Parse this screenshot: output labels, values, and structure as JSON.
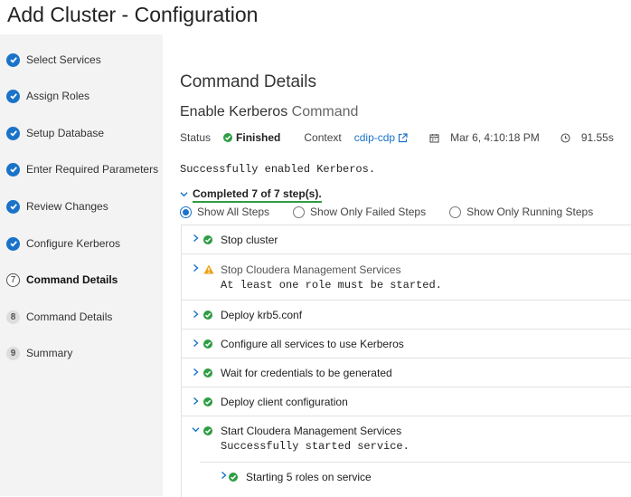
{
  "window": {
    "title": "Add Cluster - Configuration"
  },
  "sidebar": {
    "steps": [
      {
        "label": "Select Services",
        "state": "done"
      },
      {
        "label": "Assign Roles",
        "state": "done"
      },
      {
        "label": "Setup Database",
        "state": "done"
      },
      {
        "label": "Enter Required Parameters",
        "state": "done"
      },
      {
        "label": "Review Changes",
        "state": "done"
      },
      {
        "label": "Configure Kerberos",
        "state": "done"
      },
      {
        "label": "Command Details",
        "state": "current",
        "number": "7"
      },
      {
        "label": "Command Details",
        "state": "pending",
        "number": "8"
      },
      {
        "label": "Summary",
        "state": "pending",
        "number": "9"
      }
    ]
  },
  "main": {
    "title": "Command Details",
    "command_name": "Enable Kerberos",
    "command_suffix": "Command",
    "status_label": "Status",
    "status_value": "Finished",
    "context_label": "Context",
    "context_value": "cdip-cdp",
    "timestamp": "Mar 6, 4:10:18 PM",
    "duration": "91.55s",
    "result_message": "Successfully enabled Kerberos.",
    "completed_text": "Completed 7 of 7 step(s).",
    "filters": [
      {
        "label": "Show All Steps",
        "selected": true
      },
      {
        "label": "Show Only Failed Steps",
        "selected": false
      },
      {
        "label": "Show Only Running Steps",
        "selected": false
      }
    ],
    "steps": [
      {
        "name": "Stop cluster",
        "status": "success",
        "expanded": false
      },
      {
        "name": "Stop Cloudera Management Services",
        "status": "warning",
        "expanded": false,
        "detail": "At least one role must be started."
      },
      {
        "name": "Deploy krb5.conf",
        "status": "success",
        "expanded": false
      },
      {
        "name": "Configure all services to use Kerberos",
        "status": "success",
        "expanded": false
      },
      {
        "name": "Wait for credentials to be generated",
        "status": "success",
        "expanded": false
      },
      {
        "name": "Deploy client configuration",
        "status": "success",
        "expanded": false
      },
      {
        "name": "Start Cloudera Management Services",
        "status": "success",
        "expanded": true,
        "detail": "Successfully started service."
      }
    ],
    "substep": {
      "name": "Starting 5 roles on service",
      "status": "success"
    }
  },
  "colors": {
    "accent": "#1a73c8",
    "success": "#2e9d43",
    "warning": "#f0a21a",
    "sidebar_bg": "#f3f3f3"
  }
}
